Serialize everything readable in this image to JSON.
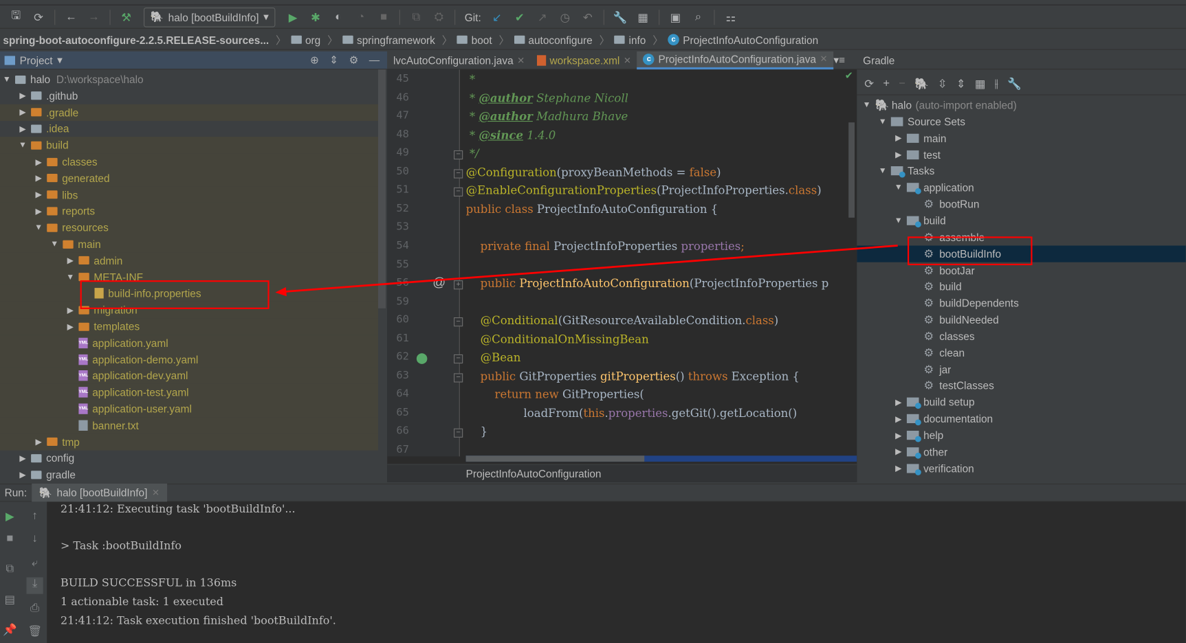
{
  "toolbar": {
    "run_config": "halo [bootBuildInfo]",
    "git_label": "Git:",
    "icons": [
      "save-icon",
      "sync-icon",
      "back-icon",
      "forward-icon",
      "build-hammer-icon",
      "run-icon",
      "debug-icon",
      "coverage-icon",
      "profile-icon",
      "stop-icon",
      "git-update-icon",
      "git-commit-icon",
      "git-push-icon",
      "history-icon",
      "revert-icon",
      "settings-wrench-icon",
      "project-structure-icon",
      "terminal-icon",
      "search-icon",
      "sdk-icon"
    ]
  },
  "breadcrumb": [
    "spring-boot-autoconfigure-2.2.5.RELEASE-sources...",
    "org",
    "springframework",
    "boot",
    "autoconfigure",
    "info",
    "ProjectInfoAutoConfiguration"
  ],
  "project_panel": {
    "title": "Project",
    "tree": [
      {
        "label": "halo",
        "hint": "D:\\workspace\\halo",
        "depth": 0,
        "arrow": "open",
        "icon": "module",
        "style": "norm"
      },
      {
        "label": ".github",
        "depth": 1,
        "arrow": "closed",
        "icon": "folder",
        "style": "norm"
      },
      {
        "label": ".gradle",
        "depth": 1,
        "arrow": "closed",
        "icon": "folder-orange",
        "style": "excl"
      },
      {
        "label": ".idea",
        "depth": 1,
        "arrow": "closed",
        "icon": "folder",
        "style": "excl-light"
      },
      {
        "label": "build",
        "depth": 1,
        "arrow": "open",
        "icon": "folder-orange",
        "style": "excl"
      },
      {
        "label": "classes",
        "depth": 2,
        "arrow": "closed",
        "icon": "folder-orange",
        "style": "excl"
      },
      {
        "label": "generated",
        "depth": 2,
        "arrow": "closed",
        "icon": "folder-orange",
        "style": "excl"
      },
      {
        "label": "libs",
        "depth": 2,
        "arrow": "closed",
        "icon": "folder-orange",
        "style": "excl"
      },
      {
        "label": "reports",
        "depth": 2,
        "arrow": "closed",
        "icon": "folder-orange",
        "style": "excl"
      },
      {
        "label": "resources",
        "depth": 2,
        "arrow": "open",
        "icon": "folder-orange",
        "style": "excl"
      },
      {
        "label": "main",
        "depth": 3,
        "arrow": "open",
        "icon": "folder-orange",
        "style": "excl"
      },
      {
        "label": "admin",
        "depth": 4,
        "arrow": "closed",
        "icon": "folder-orange",
        "style": "excl"
      },
      {
        "label": "META-INF",
        "depth": 4,
        "arrow": "open",
        "icon": "folder-orange",
        "style": "excl"
      },
      {
        "label": "build-info.properties",
        "depth": 5,
        "arrow": "",
        "icon": "properties-file",
        "style": "excl"
      },
      {
        "label": "migration",
        "depth": 4,
        "arrow": "closed",
        "icon": "folder-orange",
        "style": "excl"
      },
      {
        "label": "templates",
        "depth": 4,
        "arrow": "closed",
        "icon": "folder-orange",
        "style": "excl"
      },
      {
        "label": "application.yaml",
        "depth": 4,
        "arrow": "",
        "icon": "yml",
        "style": "excl"
      },
      {
        "label": "application-demo.yaml",
        "depth": 4,
        "arrow": "",
        "icon": "yml",
        "style": "excl"
      },
      {
        "label": "application-dev.yaml",
        "depth": 4,
        "arrow": "",
        "icon": "yml",
        "style": "excl"
      },
      {
        "label": "application-test.yaml",
        "depth": 4,
        "arrow": "",
        "icon": "yml",
        "style": "excl"
      },
      {
        "label": "application-user.yaml",
        "depth": 4,
        "arrow": "",
        "icon": "yml",
        "style": "excl"
      },
      {
        "label": "banner.txt",
        "depth": 4,
        "arrow": "",
        "icon": "text-file",
        "style": "excl"
      },
      {
        "label": "tmp",
        "depth": 2,
        "arrow": "closed",
        "icon": "folder-orange",
        "style": "excl"
      },
      {
        "label": "config",
        "depth": 1,
        "arrow": "closed",
        "icon": "folder",
        "style": "norm"
      },
      {
        "label": "gradle",
        "depth": 1,
        "arrow": "closed",
        "icon": "folder",
        "style": "norm"
      }
    ]
  },
  "editor": {
    "tabs": [
      {
        "label": "lvcAutoConfiguration.java",
        "active": false
      },
      {
        "label": "workspace.xml",
        "active": false
      },
      {
        "label": "ProjectInfoAutoConfiguration.java",
        "active": true
      }
    ],
    "lines": [
      {
        "n": "45",
        "tokens": [
          [
            " *",
            "cm"
          ]
        ]
      },
      {
        "n": "46",
        "tokens": [
          [
            " * ",
            "cm"
          ],
          [
            "@author",
            "tag"
          ],
          [
            " Stephane Nicoll",
            "cm"
          ]
        ]
      },
      {
        "n": "47",
        "tokens": [
          [
            " * ",
            "cm"
          ],
          [
            "@author",
            "tag"
          ],
          [
            " Madhura Bhave",
            "cm"
          ]
        ]
      },
      {
        "n": "48",
        "tokens": [
          [
            " * ",
            "cm"
          ],
          [
            "@since",
            "tag"
          ],
          [
            " 1.4.0",
            "cm"
          ]
        ]
      },
      {
        "n": "49",
        "tokens": [
          [
            " */",
            "cm"
          ]
        ]
      },
      {
        "n": "50",
        "tokens": [
          [
            "@Configuration",
            "an"
          ],
          [
            "(proxyBeanMethods = ",
            "pl"
          ],
          [
            "false",
            "k"
          ],
          [
            ")",
            "pl"
          ]
        ]
      },
      {
        "n": "51",
        "tokens": [
          [
            "@EnableConfigurationProperties",
            "an"
          ],
          [
            "(ProjectInfoProperties.",
            "pl"
          ],
          [
            "class",
            "k"
          ],
          [
            ")",
            "pl"
          ]
        ]
      },
      {
        "n": "52",
        "tokens": [
          [
            "public class ",
            "k"
          ],
          [
            "ProjectInfoAutoConfiguration {",
            "pl"
          ]
        ]
      },
      {
        "n": "53",
        "tokens": []
      },
      {
        "n": "54",
        "tokens": [
          [
            "    private final ",
            "k"
          ],
          [
            "ProjectInfoProperties ",
            "pl"
          ],
          [
            "properties",
            "fld"
          ],
          [
            ";",
            "k"
          ]
        ]
      },
      {
        "n": "55",
        "tokens": []
      },
      {
        "n": "56",
        "tokens": [
          [
            "    public ",
            "k"
          ],
          [
            "ProjectInfoAutoConfiguration",
            "fn"
          ],
          [
            "(ProjectInfoProperties p",
            "pl"
          ]
        ]
      },
      {
        "n": "59",
        "tokens": []
      },
      {
        "n": "60",
        "tokens": [
          [
            "    @Conditional",
            "an"
          ],
          [
            "(GitResourceAvailableCondition.",
            "pl"
          ],
          [
            "class",
            "k"
          ],
          [
            ")",
            "pl"
          ]
        ]
      },
      {
        "n": "61",
        "tokens": [
          [
            "    @ConditionalOnMissingBean",
            "an"
          ]
        ]
      },
      {
        "n": "62",
        "tokens": [
          [
            "    @Bean",
            "an"
          ]
        ]
      },
      {
        "n": "63",
        "tokens": [
          [
            "    public ",
            "k"
          ],
          [
            "GitProperties ",
            "pl"
          ],
          [
            "gitProperties",
            "fn"
          ],
          [
            "() ",
            "pl"
          ],
          [
            "throws ",
            "k"
          ],
          [
            "Exception {",
            "pl"
          ]
        ]
      },
      {
        "n": "64",
        "tokens": [
          [
            "        return new ",
            "k"
          ],
          [
            "GitProperties(",
            "pl"
          ]
        ]
      },
      {
        "n": "65",
        "tokens": [
          [
            "                loadFrom(",
            "pl"
          ],
          [
            "this",
            "k"
          ],
          [
            ".",
            "pl"
          ],
          [
            "properties",
            "fld"
          ],
          [
            ".getGit().getLocation()",
            "pl"
          ]
        ]
      },
      {
        "n": "66",
        "tokens": [
          [
            "    }",
            "pl"
          ]
        ]
      },
      {
        "n": "67",
        "tokens": []
      }
    ],
    "footer_breadcrumb": "ProjectInfoAutoConfiguration"
  },
  "gradle_panel": {
    "title": "Gradle",
    "tree": [
      {
        "label": "halo",
        "hint": "(auto-import enabled)",
        "depth": 0,
        "arrow": "open",
        "icon": "elephant"
      },
      {
        "label": "Source Sets",
        "depth": 1,
        "arrow": "open",
        "icon": "folder"
      },
      {
        "label": "main",
        "depth": 2,
        "arrow": "closed",
        "icon": "folder"
      },
      {
        "label": "test",
        "depth": 2,
        "arrow": "closed",
        "icon": "folder"
      },
      {
        "label": "Tasks",
        "depth": 1,
        "arrow": "open",
        "icon": "task-folder"
      },
      {
        "label": "application",
        "depth": 2,
        "arrow": "open",
        "icon": "task-folder"
      },
      {
        "label": "bootRun",
        "depth": 3,
        "arrow": "",
        "icon": "gear"
      },
      {
        "label": "build",
        "depth": 2,
        "arrow": "open",
        "icon": "task-folder"
      },
      {
        "label": "assemble",
        "depth": 3,
        "arrow": "",
        "icon": "gear"
      },
      {
        "label": "bootBuildInfo",
        "depth": 3,
        "arrow": "",
        "icon": "gear",
        "selected": true
      },
      {
        "label": "bootJar",
        "depth": 3,
        "arrow": "",
        "icon": "gear"
      },
      {
        "label": "build",
        "depth": 3,
        "arrow": "",
        "icon": "gear"
      },
      {
        "label": "buildDependents",
        "depth": 3,
        "arrow": "",
        "icon": "gear"
      },
      {
        "label": "buildNeeded",
        "depth": 3,
        "arrow": "",
        "icon": "gear"
      },
      {
        "label": "classes",
        "depth": 3,
        "arrow": "",
        "icon": "gear"
      },
      {
        "label": "clean",
        "depth": 3,
        "arrow": "",
        "icon": "gear"
      },
      {
        "label": "jar",
        "depth": 3,
        "arrow": "",
        "icon": "gear"
      },
      {
        "label": "testClasses",
        "depth": 3,
        "arrow": "",
        "icon": "gear"
      },
      {
        "label": "build setup",
        "depth": 2,
        "arrow": "closed",
        "icon": "task-folder"
      },
      {
        "label": "documentation",
        "depth": 2,
        "arrow": "closed",
        "icon": "task-folder"
      },
      {
        "label": "help",
        "depth": 2,
        "arrow": "closed",
        "icon": "task-folder"
      },
      {
        "label": "other",
        "depth": 2,
        "arrow": "closed",
        "icon": "task-folder"
      },
      {
        "label": "verification",
        "depth": 2,
        "arrow": "closed",
        "icon": "task-folder"
      }
    ]
  },
  "run_panel": {
    "label": "Run:",
    "tab": "halo [bootBuildInfo]",
    "console": [
      "21:41:12: Executing task 'bootBuildInfo'...",
      "",
      "> Task :bootBuildInfo",
      "",
      "BUILD SUCCESSFUL in 136ms",
      "1 actionable task: 1 executed",
      "21:41:12: Task execution finished 'bootBuildInfo'."
    ]
  },
  "colors": {
    "annotation": "#ff0000",
    "accent": "#4a88c7",
    "selection": "#0d293e",
    "excluded_text": "#b3a64c"
  }
}
